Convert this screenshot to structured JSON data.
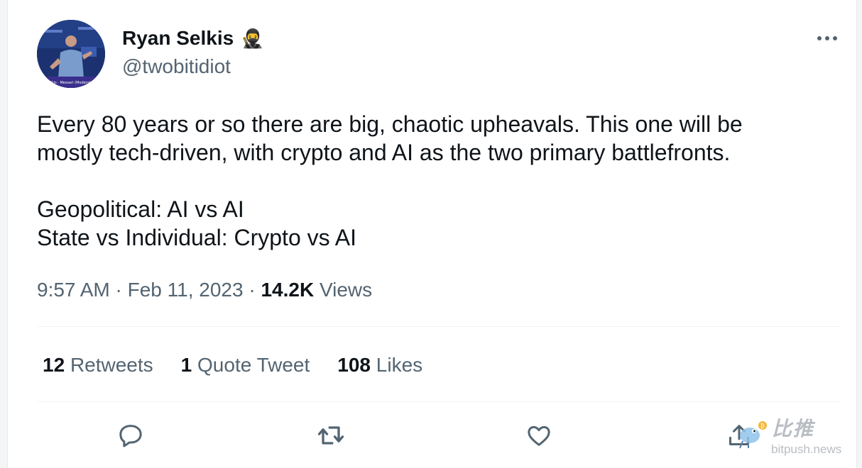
{
  "tweet": {
    "author": {
      "display_name": "Ryan Selkis",
      "emoji": "🥷",
      "handle": "@twobitidiot",
      "avatar_caption": "Selkis · Messari (Moderator)"
    },
    "text": "Every 80 years or so there are big, chaotic upheavals. This one will be\nmostly tech-driven, with crypto and AI as the two primary battlefronts.\n\nGeopolitical: AI vs AI\nState vs Individual: Crypto vs AI",
    "time": "9:57 AM",
    "date": "Feb 11, 2023",
    "separator": "·",
    "views_count": "14.2K",
    "views_label": "Views",
    "stats": {
      "retweets_count": "12",
      "retweets_label": "Retweets",
      "quotes_count": "1",
      "quotes_label": "Quote Tweet",
      "likes_count": "108",
      "likes_label": "Likes"
    },
    "actions": [
      "reply-icon",
      "retweet-icon",
      "like-icon",
      "share-icon"
    ]
  },
  "watermark": {
    "chinese": "比推",
    "domain": "bitpush.news"
  },
  "colors": {
    "text": "#0f1419",
    "secondary": "#536471",
    "divider": "#eff3f4",
    "icon": "#536471"
  }
}
